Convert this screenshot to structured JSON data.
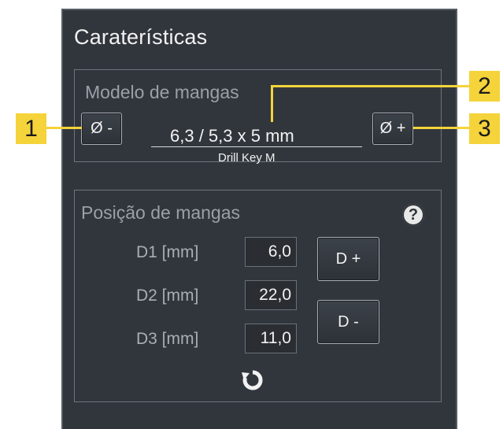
{
  "panel": {
    "title": "Caraterísticas"
  },
  "sleeve_model": {
    "title": "Modelo de mangas",
    "decrease_label": "Ø -",
    "increase_label": "Ø +",
    "size": "6,3 / 5,3 x 5 mm",
    "drill_key": "Drill Key M"
  },
  "sleeve_position": {
    "title": "Posição de mangas",
    "help": "?",
    "rows": [
      {
        "label": "D1 [mm]",
        "value": "6,0"
      },
      {
        "label": "D2 [mm]",
        "value": "22,0"
      },
      {
        "label": "D3 [mm]",
        "value": "11,0"
      }
    ],
    "d_plus_label": "D +",
    "d_minus_label": "D -"
  },
  "callouts": [
    "1",
    "2",
    "3"
  ],
  "colors": {
    "panel_bg": "#31363d",
    "callout": "#f5d33a",
    "text": "#f2f2f2",
    "muted": "#9aa0a6"
  },
  "icons": {
    "reset": "reset-icon",
    "help": "help-icon"
  }
}
